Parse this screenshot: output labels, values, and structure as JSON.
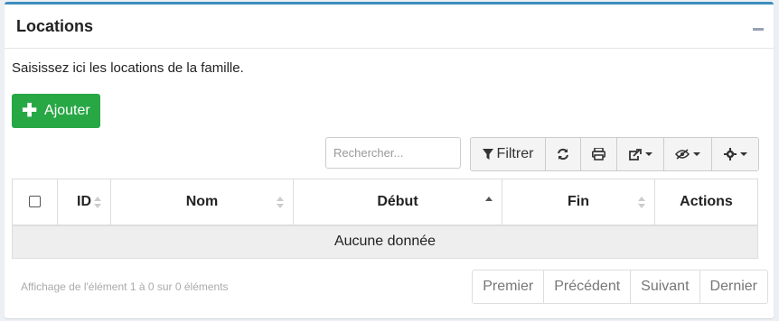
{
  "panel": {
    "title": "Locations",
    "intro": "Saisissez ici les locations de la famille.",
    "add_label": "Ajouter"
  },
  "search": {
    "placeholder": "Rechercher..."
  },
  "toolbar": {
    "filter_label": "Filtrer",
    "icons": [
      "filter-icon",
      "refresh-icon",
      "print-icon",
      "export-icon",
      "visibility-icon",
      "gear-icon"
    ]
  },
  "table": {
    "columns": [
      "ID",
      "Nom",
      "Début",
      "Fin",
      "Actions"
    ],
    "sorted_column": "Début",
    "sort_direction": "asc",
    "empty_text": "Aucune donnée"
  },
  "footer": {
    "info": "Affichage de l'élément 1 à 0 sur 0 éléments",
    "pagination": [
      "Premier",
      "Précédent",
      "Suivant",
      "Dernier"
    ]
  },
  "colors": {
    "accent": "#3c8dbc",
    "add_button": "#28a745"
  }
}
